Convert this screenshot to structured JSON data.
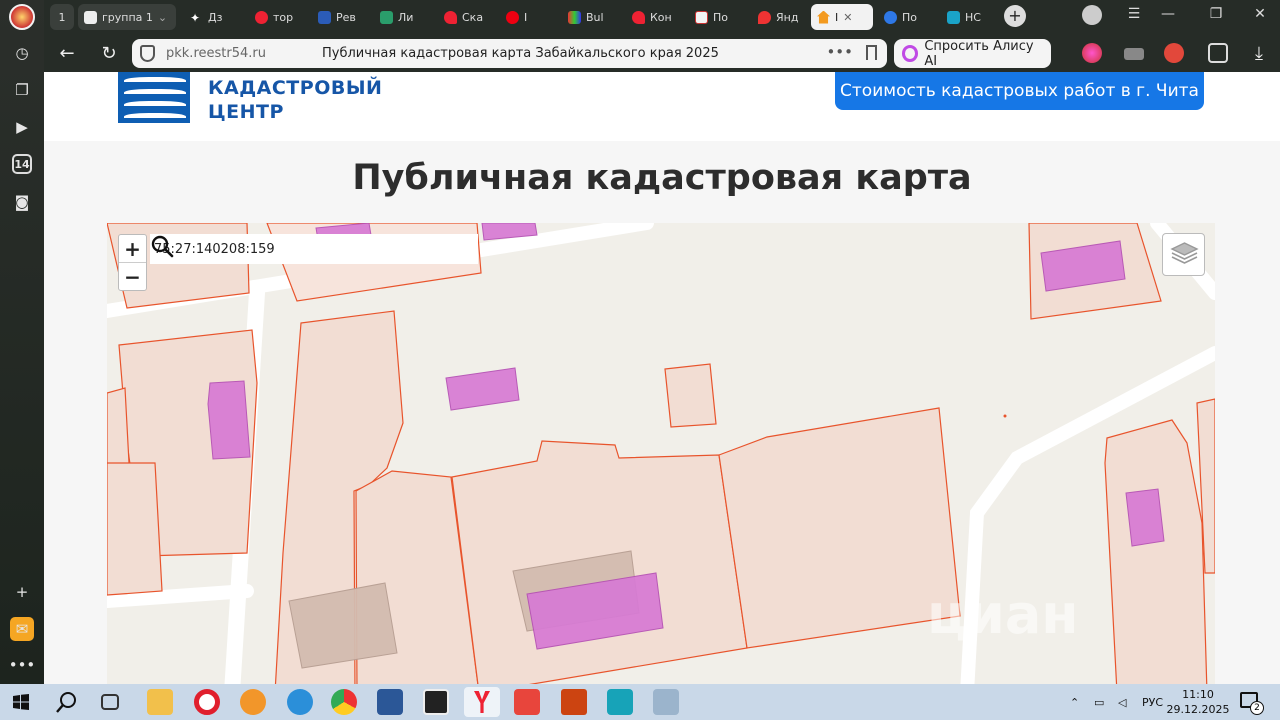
{
  "browser": {
    "tabs": [
      {
        "label": "1",
        "kind": "counter"
      },
      {
        "label": "группа 1",
        "kind": "group"
      },
      {
        "label": "Дз",
        "icon": "sparkle-icon"
      },
      {
        "label": "тор",
        "icon": "yandex-icon"
      },
      {
        "label": "Рев",
        "icon": "crest-icon"
      },
      {
        "label": "Ли",
        "icon": "map-flag-icon"
      },
      {
        "label": "Ска",
        "icon": "heart-icon"
      },
      {
        "label": "I",
        "icon": "youtube-icon"
      },
      {
        "label": "Bul",
        "icon": "grid-icon"
      },
      {
        "label": "Кон",
        "icon": "heart-icon"
      },
      {
        "label": "По",
        "icon": "doc-icon"
      },
      {
        "label": "Янд",
        "icon": "pin-icon"
      },
      {
        "label": "I",
        "icon": "home-icon",
        "active": true
      },
      {
        "label": "По",
        "icon": "mail-icon"
      },
      {
        "label": "НС",
        "icon": "ns-icon"
      }
    ],
    "address": {
      "domain": "pkk.reestr54.ru",
      "page_title": "Публичная кадастровая карта Забайкальского края 2025",
      "more": "•••"
    },
    "alice_label": "Спросить Алису AI"
  },
  "site": {
    "logo_line1": "КАДАСТРОВЫЙ",
    "logo_line2": "ЦЕНТР",
    "cta_label": "Стоимость кадастровых работ в г. Чита",
    "title": "Публичная кадастровая карта"
  },
  "map": {
    "zoom_in": "+",
    "zoom_out": "−",
    "search_value": "75:27:140208:159",
    "watermark": "циан"
  },
  "taskbar": {
    "language": "РУС",
    "time": "11:10",
    "date": "29.12.2025",
    "notifications": "2"
  },
  "colors": {
    "parcel_fill": "#f2ddd3",
    "parcel_stroke": "#e8542c",
    "building_fill": "#d77ad4",
    "cta": "#1677e6",
    "brand": "#1656a7"
  }
}
